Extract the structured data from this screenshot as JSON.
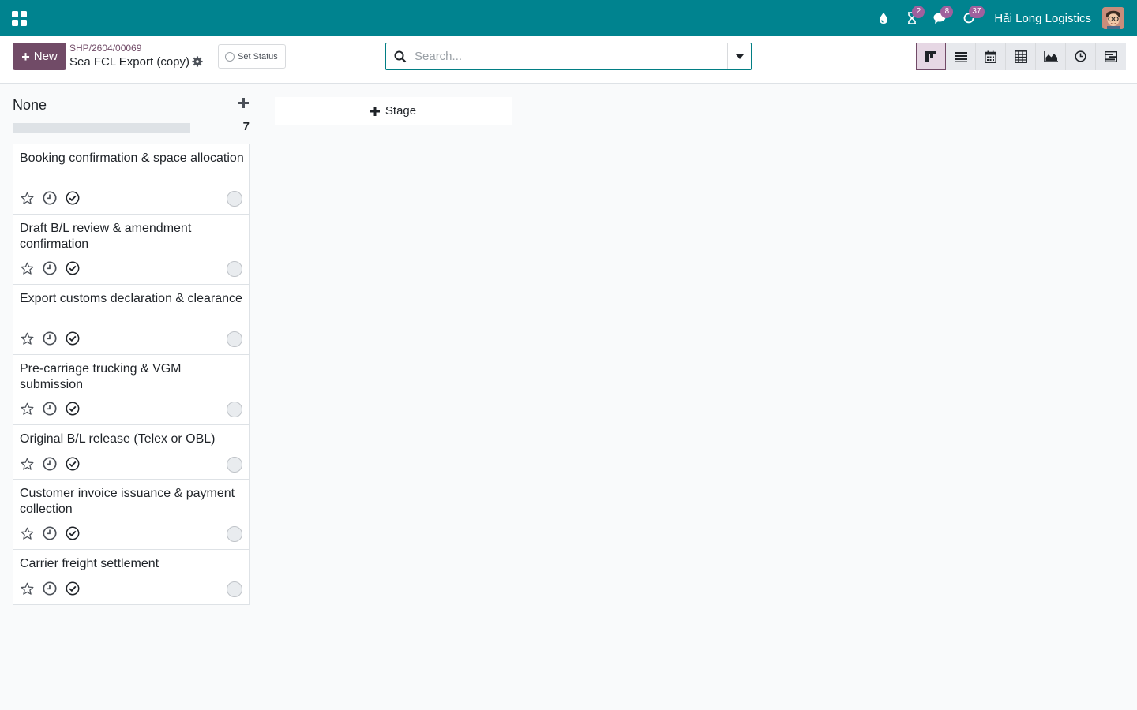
{
  "navbar": {
    "company": "Hải Long Logistics",
    "badges": {
      "activity": "2",
      "messages": "8",
      "updates": "37"
    },
    "colors": {
      "bar": "#00838f",
      "badge": "#a0609d"
    }
  },
  "control": {
    "new_label": "New",
    "breadcrumb": "SHP/2604/00069",
    "title": "Sea FCL Export (copy)",
    "set_status": "Set Status",
    "search_placeholder": "Search...",
    "views": [
      "kanban",
      "list",
      "calendar",
      "pivot",
      "graph",
      "activity",
      "gantt"
    ],
    "active_view": "kanban",
    "brand_color": "#714b67"
  },
  "kanban": {
    "column_title": "None",
    "count": "7",
    "stage_label": "Stage",
    "cards": [
      {
        "title": "Booking confirmation & space allocation"
      },
      {
        "title": "Draft B/L review & amendment confirmation"
      },
      {
        "title": "Export customs declaration & clearance"
      },
      {
        "title": "Pre-carriage trucking & VGM submission"
      },
      {
        "title": "Original B/L release (Telex or OBL)"
      },
      {
        "title": "Customer invoice issuance & payment collection"
      },
      {
        "title": "Carrier freight settlement"
      }
    ]
  }
}
